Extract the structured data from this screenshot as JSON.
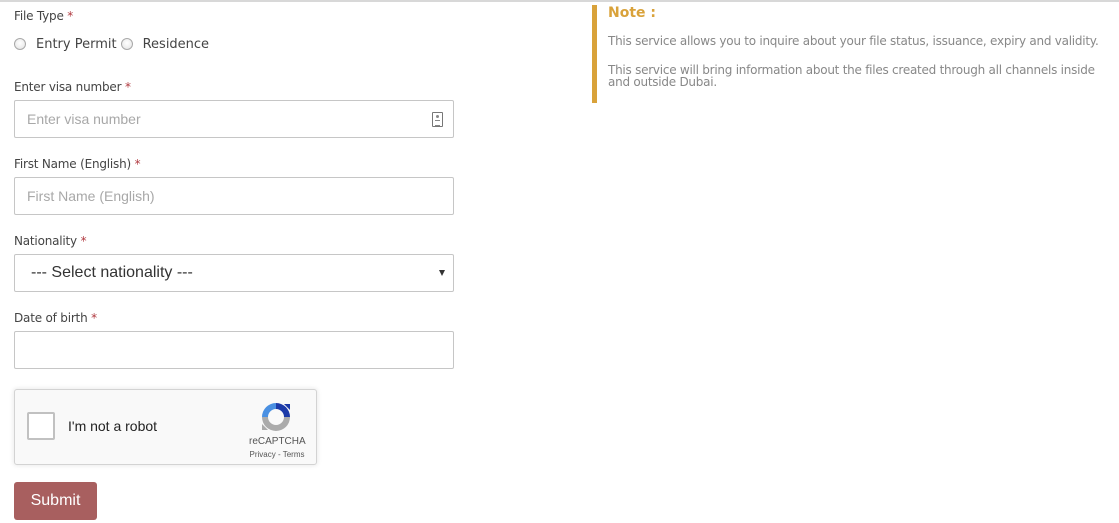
{
  "form": {
    "file_type": {
      "label": "File Type",
      "required_mark": "*",
      "options": [
        {
          "label": "Entry Permit",
          "selected": false
        },
        {
          "label": "Residence",
          "selected": false
        }
      ]
    },
    "visa_number": {
      "label": "Enter visa number",
      "required_mark": "*",
      "placeholder": "Enter visa number",
      "value": "",
      "icon": "id-card-icon"
    },
    "first_name": {
      "label": "First Name (English)",
      "required_mark": "*",
      "placeholder": "First Name (English)",
      "value": ""
    },
    "nationality": {
      "label": "Nationality",
      "required_mark": "*",
      "selected": "--- Select nationality ---"
    },
    "date_of_birth": {
      "label": "Date of birth",
      "required_mark": "*",
      "value": ""
    },
    "recaptcha": {
      "checkbox_label": "I'm not a robot",
      "brand": "reCAPTCHA",
      "links": "Privacy - Terms",
      "checked": false
    },
    "submit_label": "Submit"
  },
  "note": {
    "title": "Note :",
    "paragraphs": [
      "This service allows you to inquire about your file status, issuance, expiry and validity.",
      "This service will bring information about the files created through all channels inside and outside Dubai."
    ]
  },
  "colors": {
    "required": "#b0393f",
    "submit_bg": "#a85f5f",
    "note_accent": "#d9a23a",
    "note_text": "#888888"
  }
}
